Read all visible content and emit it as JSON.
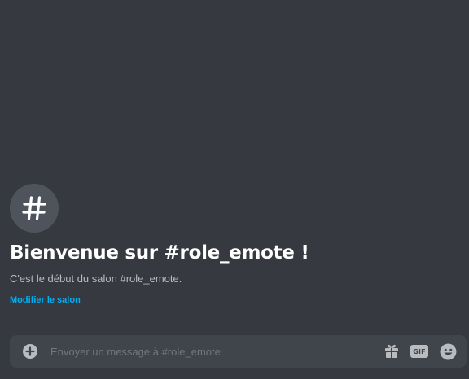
{
  "channel": {
    "name": "role_emote",
    "icon": "hash-icon"
  },
  "welcome": {
    "title": "Bienvenue sur #role_emote !",
    "subtitle": "C'est le début du salon #role_emote.",
    "edit_link": "Modifier le salon"
  },
  "composer": {
    "placeholder": "Envoyer un message à #role_emote",
    "value": "",
    "attach_icon": "plus-circle-icon",
    "gift_icon": "gift-icon",
    "gif_label": "GIF",
    "emoji_icon": "smiley-icon"
  },
  "colors": {
    "background": "#36393f",
    "composer_background": "#40444b",
    "link": "#00aff4",
    "title": "#ffffff",
    "subtitle": "#b9bbbe"
  }
}
